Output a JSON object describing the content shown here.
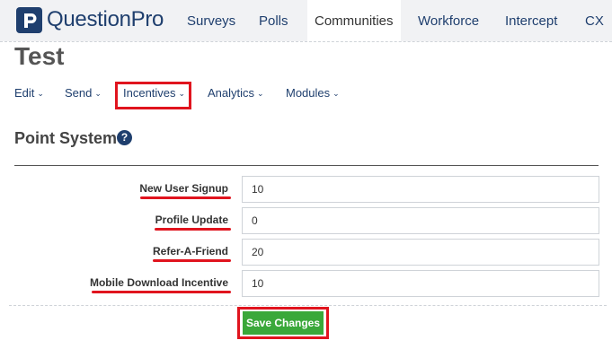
{
  "brand": {
    "name": "QuestionPro",
    "color": "#1f3f6e"
  },
  "topnav": {
    "tabs": [
      {
        "label": "Surveys"
      },
      {
        "label": "Polls"
      },
      {
        "label": "Communities",
        "active": true
      },
      {
        "label": "Workforce"
      },
      {
        "label": "Intercept"
      },
      {
        "label": "CX"
      }
    ]
  },
  "page": {
    "title": "Test"
  },
  "subnav": {
    "items": [
      {
        "label": "Edit"
      },
      {
        "label": "Send"
      },
      {
        "label": "Incentives",
        "highlighted": true
      },
      {
        "label": "Analytics"
      },
      {
        "label": "Modules"
      }
    ]
  },
  "section": {
    "title": "Point System",
    "help_icon": "question-circle-icon"
  },
  "fields": [
    {
      "label": "New User Signup",
      "value": "10"
    },
    {
      "label": "Profile Update",
      "value": "0"
    },
    {
      "label": "Refer-A-Friend",
      "value": "20"
    },
    {
      "label": "Mobile Download Incentive",
      "value": "10"
    }
  ],
  "actions": {
    "save_label": "Save Changes"
  },
  "colors": {
    "highlight": "#e0141e",
    "save_button": "#3aa83a"
  }
}
